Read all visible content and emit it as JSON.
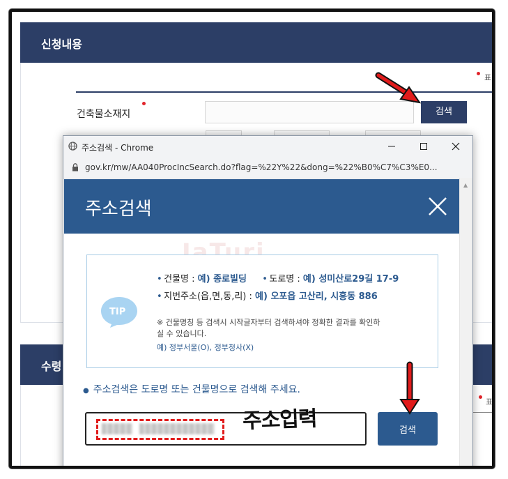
{
  "background_page": {
    "section1_title": "신청내용",
    "section2_title": "수령",
    "required_note": "표",
    "required_note2": "표",
    "field_label": "건축물소재지",
    "search_button": "검색"
  },
  "popup_window": {
    "window_title": "주소검색 - Chrome",
    "url": "gov.kr/mw/AA040ProcIncSearch.do?flag=%22Y%22&dong=%22%B0%C7%C3%E0...",
    "controls": {
      "minimize": "—",
      "maximize": "☐",
      "close": "✕"
    },
    "header_title": "주소검색",
    "watermark": "JaTuri",
    "tip": {
      "badge": "TIP",
      "line1_a_label": "건물명 : ",
      "line1_a_value": "예) 종로빌딩",
      "line1_b_label": "도로명 : ",
      "line1_b_value": "예) 성미산로29길 17-9",
      "line2_label": "지번주소(읍,면,동,리) : ",
      "line2_value": "예) 오포읍 고산리, 시흥동 886",
      "note1": "※ 건물명칭 등 검색시 시작글자부터 검색하셔야 정확한 결과를 확인하",
      "note2": "실 수 있습니다.",
      "note3": "예) 정부서울(O), 정부청사(X)"
    },
    "guide_text": "주소검색은 도로명 또는 건물명으로 검색해 주세요.",
    "search_button": "검색",
    "annotation": "주소입력"
  },
  "colors": {
    "navy": "#2c3e66",
    "popup_blue": "#2c5a8f",
    "arrow_red": "#e11b1b",
    "tip_blue": "#a9d4f2"
  }
}
